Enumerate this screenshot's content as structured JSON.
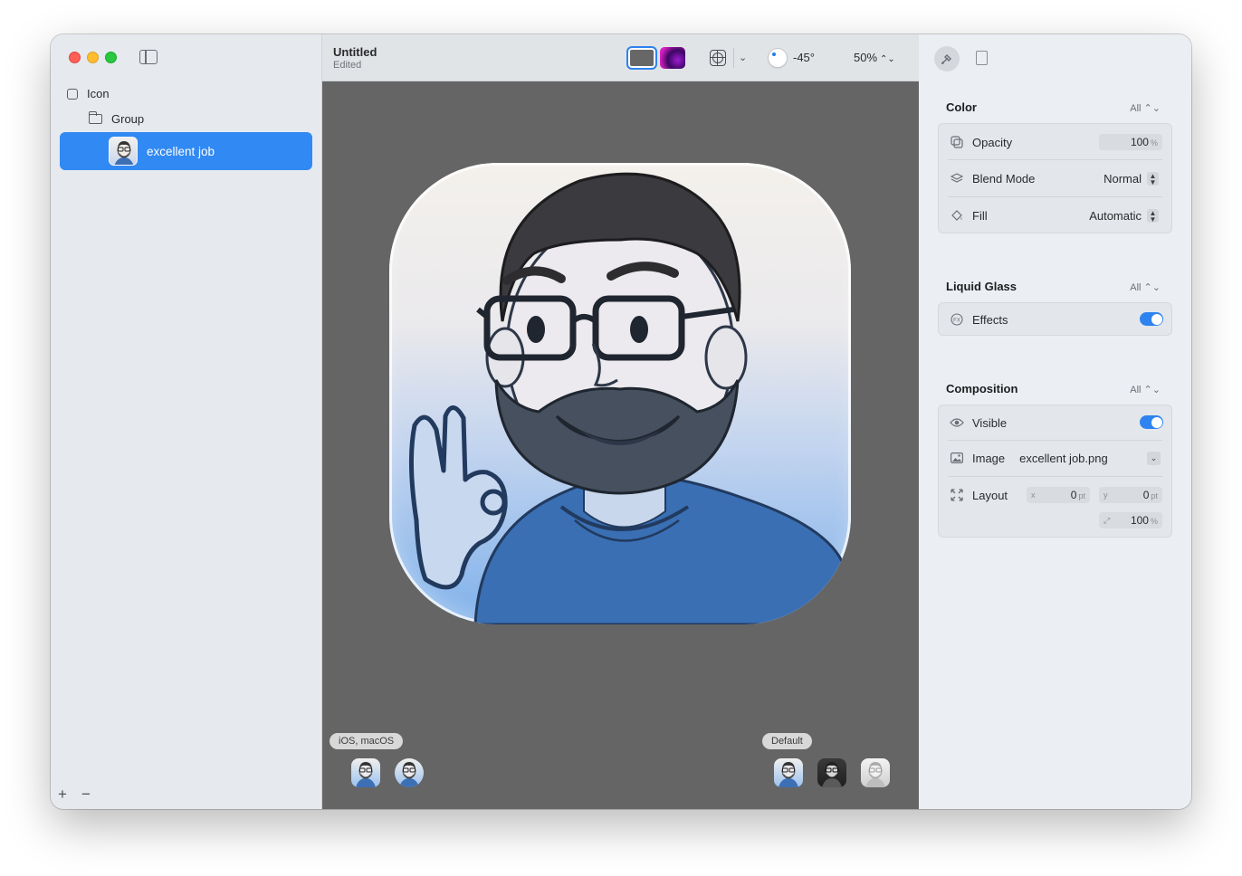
{
  "sidebar": {
    "tree": {
      "root_label": "Icon",
      "group_label": "Group",
      "selected_label": "excellent job"
    },
    "add_symbol": "+",
    "remove_symbol": "−"
  },
  "toolbar": {
    "title": "Untitled",
    "subtitle": "Edited",
    "light_angle": "-45°",
    "zoom": "50%",
    "zoom_arrows": "⌃⌄"
  },
  "canvas": {
    "left_platform_label": "iOS, macOS",
    "right_appearance_label": "Default"
  },
  "inspector": {
    "color": {
      "title": "Color",
      "scope": "All ⌃⌄",
      "opacity_label": "Opacity",
      "opacity_value": "100",
      "opacity_unit": "%",
      "blend_label": "Blend Mode",
      "blend_value": "Normal",
      "fill_label": "Fill",
      "fill_value": "Automatic"
    },
    "liquid_glass": {
      "title": "Liquid Glass",
      "scope": "All ⌃⌄",
      "effects_label": "Effects",
      "effects_on": true
    },
    "composition": {
      "title": "Composition",
      "scope": "All ⌃⌄",
      "visible_label": "Visible",
      "visible_on": true,
      "image_label": "Image",
      "image_value": "excellent job.png",
      "layout_label": "Layout",
      "x_label": "x",
      "x_value": "0",
      "y_label": "y",
      "y_value": "0",
      "pt_unit": "pt",
      "scale_value": "100",
      "scale_unit": "%"
    }
  },
  "colors": {
    "accent": "#3189f3",
    "canvas_bg": "#656565",
    "toggle_on": "#2f83f0"
  },
  "icons": [
    "sidebar-toggle-icon",
    "checkbox-icon",
    "folder-icon",
    "grid-icon",
    "light-angle-knob",
    "brush-icon",
    "document-icon",
    "opacity-icon",
    "layers-icon",
    "paint-bucket-icon",
    "fx-icon",
    "eye-icon",
    "image-icon",
    "resize-arrows-icon"
  ]
}
